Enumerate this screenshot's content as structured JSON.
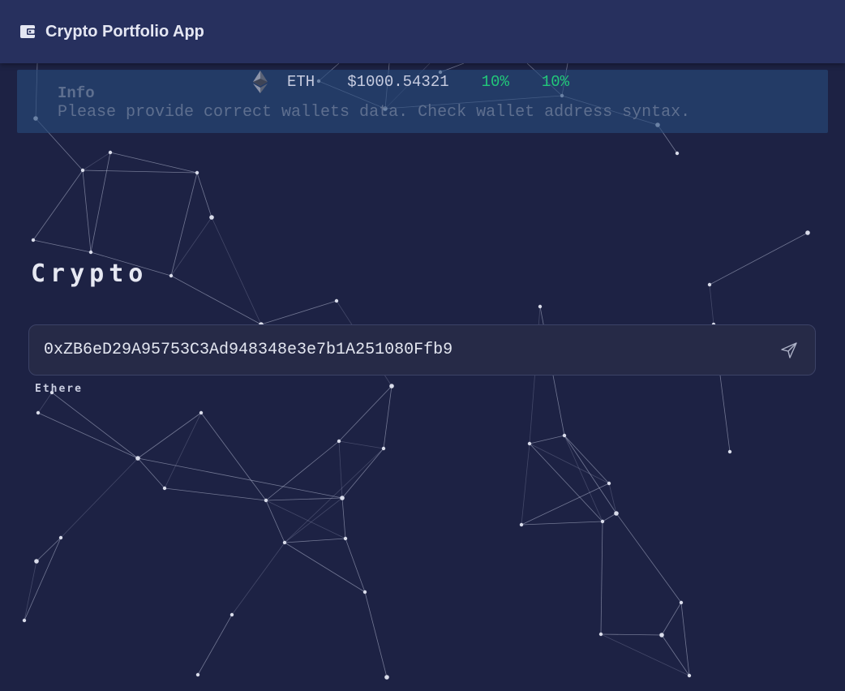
{
  "header": {
    "title": "Crypto Portfolio App",
    "logo_icon": "wallet-icon"
  },
  "info": {
    "title": "Info",
    "message": "Please provide correct wallets data. Check wallet address syntax."
  },
  "ticker": {
    "icon": "ethereum-icon",
    "symbol": "ETH",
    "price": "$1000.54321",
    "change_1": "10%",
    "change_2": "10%"
  },
  "section": {
    "title": "Crypto"
  },
  "wallet": {
    "address": "0xZB6eD29A95753C3Ad948348e3e7b1A251080Ffb9",
    "network": "Ethereum"
  },
  "colors": {
    "background": "#1d2244",
    "header": "#27305e",
    "positive": "#22c77a",
    "info_text": "#5e6f8f"
  }
}
